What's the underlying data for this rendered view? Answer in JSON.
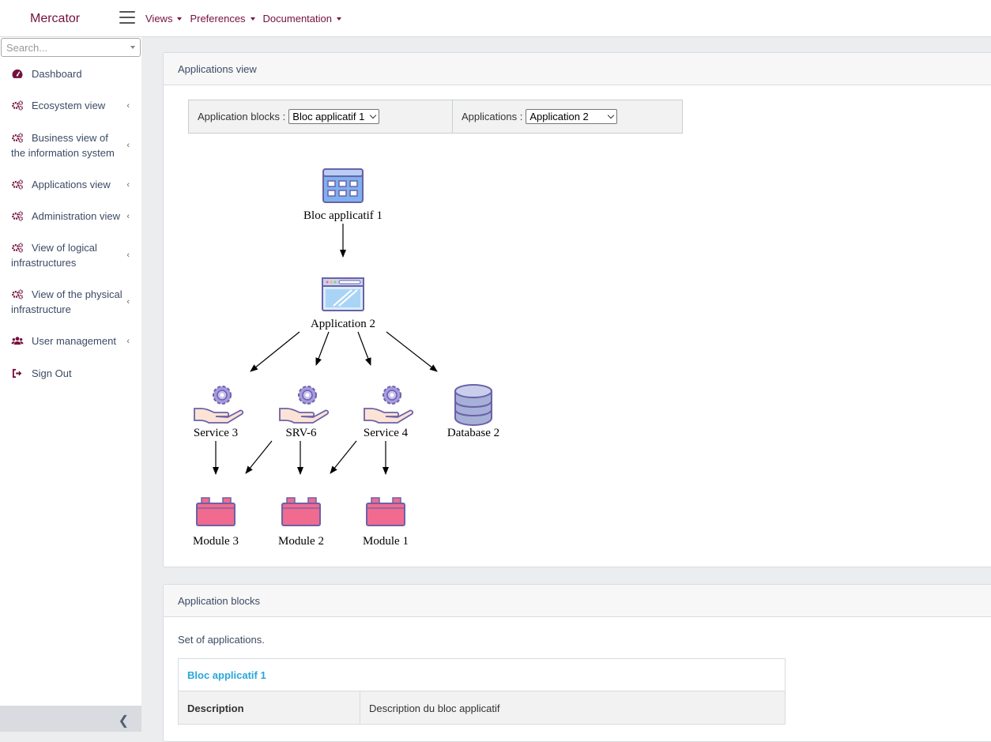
{
  "header": {
    "brand": "Mercator",
    "menu": [
      {
        "label": "Views"
      },
      {
        "label": "Preferences"
      },
      {
        "label": "Documentation"
      }
    ]
  },
  "sidebar": {
    "search_placeholder": "Search...",
    "items": [
      {
        "label": "Dashboard",
        "icon": "dashboard-icon",
        "has_children": false
      },
      {
        "label": "Ecosystem view",
        "icon": "cogs-icon",
        "has_children": true
      },
      {
        "label": "Business view of the information system",
        "icon": "cogs-icon",
        "has_children": true
      },
      {
        "label": "Applications view",
        "icon": "cogs-icon",
        "has_children": true
      },
      {
        "label": "Administration view",
        "icon": "cogs-icon",
        "has_children": true
      },
      {
        "label": "View of logical infrastructures",
        "icon": "cogs-icon",
        "has_children": true
      },
      {
        "label": "View of the physical infrastructure",
        "icon": "cogs-icon",
        "has_children": true
      },
      {
        "label": "User management",
        "icon": "users-icon",
        "has_children": true
      },
      {
        "label": "Sign Out",
        "icon": "sign-out-icon",
        "has_children": false
      }
    ]
  },
  "applications_view": {
    "title": "Applications view",
    "filter_blocks_label": "Application blocks :",
    "filter_blocks_value": "Bloc applicatif 1",
    "filter_apps_label": "Applications :",
    "filter_apps_value": "Application 2",
    "graph": {
      "nodes": [
        {
          "id": "bloc1",
          "label": "Bloc applicatif 1",
          "type": "application-block"
        },
        {
          "id": "app2",
          "label": "Application 2",
          "type": "application"
        },
        {
          "id": "svc3",
          "label": "Service 3",
          "type": "service"
        },
        {
          "id": "srv6",
          "label": "SRV-6",
          "type": "service"
        },
        {
          "id": "svc4",
          "label": "Service 4",
          "type": "service"
        },
        {
          "id": "db2",
          "label": "Database 2",
          "type": "database"
        },
        {
          "id": "mod3",
          "label": "Module 3",
          "type": "module"
        },
        {
          "id": "mod2",
          "label": "Module 2",
          "type": "module"
        },
        {
          "id": "mod1",
          "label": "Module 1",
          "type": "module"
        }
      ],
      "edges": [
        [
          "bloc1",
          "app2"
        ],
        [
          "app2",
          "svc3"
        ],
        [
          "app2",
          "srv6"
        ],
        [
          "app2",
          "svc4"
        ],
        [
          "app2",
          "db2"
        ],
        [
          "svc3",
          "mod3"
        ],
        [
          "srv6",
          "mod3"
        ],
        [
          "srv6",
          "mod2"
        ],
        [
          "svc4",
          "mod2"
        ],
        [
          "svc4",
          "mod1"
        ]
      ]
    }
  },
  "application_blocks": {
    "title": "Application blocks",
    "description": "Set of applications.",
    "block_name": "Bloc applicatif 1",
    "description_key": "Description",
    "description_value": "Description du bloc applicatif"
  },
  "colors": {
    "brand": "#76103f",
    "link": "#2aa6d8",
    "module": "#f06b8f",
    "service_gear": "#8c7ad0",
    "database": "#a7b0d8"
  }
}
